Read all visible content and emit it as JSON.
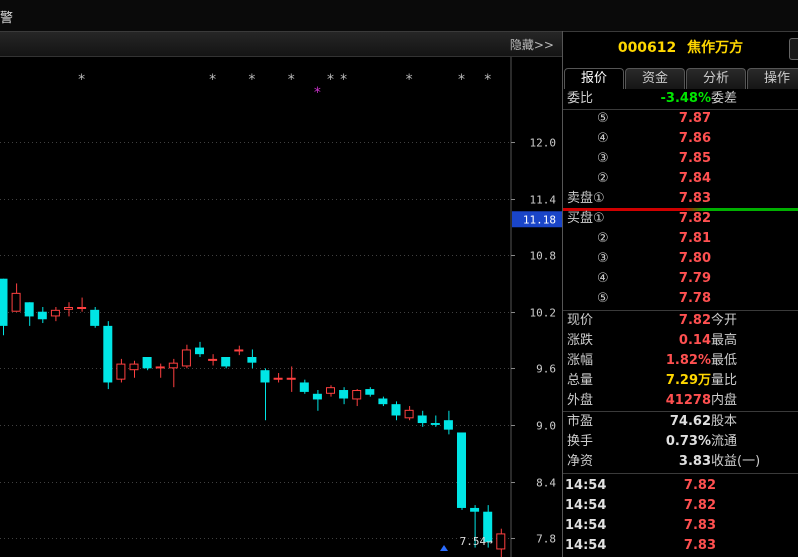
{
  "window": {
    "title_fragment": "警"
  },
  "subbar": {
    "hide_label": "隐藏>>"
  },
  "stock": {
    "code": "000612",
    "name": "焦作万方"
  },
  "tabs": [
    {
      "label": "报价",
      "active": true
    },
    {
      "label": "资金",
      "active": false
    },
    {
      "label": "分析",
      "active": false
    },
    {
      "label": "操作",
      "active": false
    }
  ],
  "commission": {
    "label": "委比",
    "value": "-3.48%",
    "label2": "委差"
  },
  "sell_orders": [
    {
      "level": "⑤",
      "price": "7.87"
    },
    {
      "level": "④",
      "price": "7.86"
    },
    {
      "level": "③",
      "price": "7.85"
    },
    {
      "level": "②",
      "price": "7.84"
    },
    {
      "level": "卖盘①",
      "price": "7.83"
    }
  ],
  "buy_orders": [
    {
      "level": "买盘①",
      "price": "7.82"
    },
    {
      "level": "②",
      "price": "7.81"
    },
    {
      "level": "③",
      "price": "7.80"
    },
    {
      "level": "④",
      "price": "7.79"
    },
    {
      "level": "⑤",
      "price": "7.78"
    }
  ],
  "quote": [
    {
      "label": "现价",
      "value": "7.82",
      "label2": "今开",
      "color": "red"
    },
    {
      "label": "涨跌",
      "value": "0.14",
      "label2": "最高",
      "color": "red"
    },
    {
      "label": "涨幅",
      "value": "1.82%",
      "label2": "最低",
      "color": "red"
    },
    {
      "label": "总量",
      "value": "7.29万",
      "label2": "量比",
      "color": "yel"
    },
    {
      "label": "外盘",
      "value": "41278",
      "label2": "内盘",
      "color": "red"
    },
    {
      "label": "市盈",
      "value": "74.62",
      "label2": "股本",
      "color": "wht"
    },
    {
      "label": "换手",
      "value": "0.73%",
      "label2": "流通",
      "color": "wht"
    },
    {
      "label": "净资",
      "value": "3.83",
      "label2": "收益(一)",
      "color": "wht"
    }
  ],
  "ticks": [
    {
      "time": "14:54",
      "price": "7.82"
    },
    {
      "time": "14:54",
      "price": "7.82"
    },
    {
      "time": "14:54",
      "price": "7.83"
    },
    {
      "time": "14:54",
      "price": "7.83"
    }
  ],
  "chart_data": {
    "type": "candlestick",
    "y_ticks": [
      "12.0",
      "11.4",
      "10.8",
      "10.2",
      "9.6",
      "9.0",
      "8.4",
      "7.8"
    ],
    "current_price_label": "11.18",
    "min_label": "7.54",
    "ylim": [
      7.6,
      12.9
    ],
    "candles": [
      {
        "o": 10.55,
        "c": 10.05,
        "h": 10.55,
        "l": 9.95
      },
      {
        "o": 10.2,
        "c": 10.4,
        "h": 10.5,
        "l": 10.2
      },
      {
        "o": 10.3,
        "c": 10.15,
        "h": 10.3,
        "l": 10.05
      },
      {
        "o": 10.2,
        "c": 10.12,
        "h": 10.25,
        "l": 10.08
      },
      {
        "o": 10.15,
        "c": 10.22,
        "h": 10.25,
        "l": 10.1
      },
      {
        "o": 10.22,
        "c": 10.25,
        "h": 10.3,
        "l": 10.15
      },
      {
        "o": 10.25,
        "c": 10.25,
        "h": 10.35,
        "l": 10.2
      },
      {
        "o": 10.22,
        "c": 10.05,
        "h": 10.25,
        "l": 10.03
      },
      {
        "o": 10.05,
        "c": 9.45,
        "h": 10.1,
        "l": 9.38
      },
      {
        "o": 9.48,
        "c": 9.65,
        "h": 9.7,
        "l": 9.45
      },
      {
        "o": 9.58,
        "c": 9.65,
        "h": 9.68,
        "l": 9.5
      },
      {
        "o": 9.72,
        "c": 9.6,
        "h": 9.72,
        "l": 9.58
      },
      {
        "o": 9.6,
        "c": 9.62,
        "h": 9.65,
        "l": 9.5
      },
      {
        "o": 9.6,
        "c": 9.66,
        "h": 9.7,
        "l": 9.4
      },
      {
        "o": 9.62,
        "c": 9.8,
        "h": 9.85,
        "l": 9.6
      },
      {
        "o": 9.82,
        "c": 9.75,
        "h": 9.88,
        "l": 9.72
      },
      {
        "o": 9.68,
        "c": 9.7,
        "h": 9.75,
        "l": 9.63
      },
      {
        "o": 9.72,
        "c": 9.62,
        "h": 9.72,
        "l": 9.6
      },
      {
        "o": 9.78,
        "c": 9.8,
        "h": 9.84,
        "l": 9.74
      },
      {
        "o": 9.72,
        "c": 9.66,
        "h": 9.8,
        "l": 9.6
      },
      {
        "o": 9.58,
        "c": 9.45,
        "h": 9.6,
        "l": 9.05
      },
      {
        "o": 9.48,
        "c": 9.5,
        "h": 9.55,
        "l": 9.45
      },
      {
        "o": 9.5,
        "c": 9.5,
        "h": 9.62,
        "l": 9.35
      },
      {
        "o": 9.45,
        "c": 9.35,
        "h": 9.48,
        "l": 9.33
      },
      {
        "o": 9.33,
        "c": 9.27,
        "h": 9.37,
        "l": 9.15
      },
      {
        "o": 9.33,
        "c": 9.4,
        "h": 9.42,
        "l": 9.3
      },
      {
        "o": 9.37,
        "c": 9.28,
        "h": 9.4,
        "l": 9.22
      },
      {
        "o": 9.27,
        "c": 9.37,
        "h": 9.38,
        "l": 9.2
      },
      {
        "o": 9.38,
        "c": 9.32,
        "h": 9.4,
        "l": 9.3
      },
      {
        "o": 9.28,
        "c": 9.22,
        "h": 9.3,
        "l": 9.2
      },
      {
        "o": 9.22,
        "c": 9.1,
        "h": 9.25,
        "l": 9.05
      },
      {
        "o": 9.07,
        "c": 9.16,
        "h": 9.2,
        "l": 9.05
      },
      {
        "o": 9.1,
        "c": 9.02,
        "h": 9.15,
        "l": 8.98
      },
      {
        "o": 9.02,
        "c": 9.0,
        "h": 9.1,
        "l": 8.98
      },
      {
        "o": 9.05,
        "c": 8.95,
        "h": 9.15,
        "l": 8.9
      },
      {
        "o": 8.92,
        "c": 8.12,
        "h": 8.92,
        "l": 8.1
      },
      {
        "o": 8.12,
        "c": 8.08,
        "h": 8.15,
        "l": 7.7
      },
      {
        "o": 8.08,
        "c": 7.76,
        "h": 8.15,
        "l": 7.7
      },
      {
        "o": 7.68,
        "c": 7.85,
        "h": 7.9,
        "l": 7.6
      }
    ],
    "markers": [
      {
        "candle": 6,
        "color": "#bbbbbb"
      },
      {
        "candle": 16,
        "color": "#bbbbbb"
      },
      {
        "candle": 19,
        "color": "#bbbbbb"
      },
      {
        "candle": 22,
        "color": "#bbbbbb"
      },
      {
        "candle": 25,
        "color": "#bbbbbb"
      },
      {
        "candle": 26,
        "color": "#bbbbbb"
      },
      {
        "candle": 24,
        "color": "#cc33cc",
        "low": true
      },
      {
        "candle": 31,
        "color": "#bbbbbb"
      },
      {
        "candle": 35,
        "color": "#bbbbbb"
      },
      {
        "candle": 37,
        "color": "#bbbbbb"
      }
    ],
    "colors": {
      "up": "#ff4040",
      "down": "#00e5e5",
      "grid": "#404040",
      "label_box": "#1a45c8"
    }
  }
}
